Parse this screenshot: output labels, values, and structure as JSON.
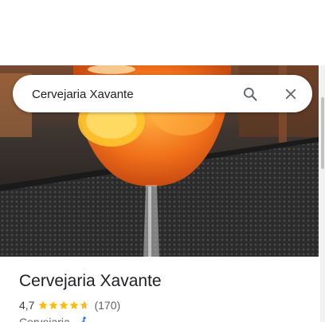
{
  "search": {
    "value": "Cervejaria Xavante",
    "search_icon": "search-icon",
    "close_icon": "close-icon"
  },
  "hero_photo": {
    "description_icon": "photo"
  },
  "place": {
    "name": "Cervejaria Xavante",
    "rating": "4,7",
    "stars": 4.7,
    "reviews": "(170)",
    "category": "Cervejaria",
    "separator": "·",
    "accessibility_icon": "wheelchair-icon"
  },
  "colors": {
    "star": "#fbbc04",
    "text_primary": "#202124",
    "text_secondary": "#5f6368",
    "accessibility": "#1a73e8"
  }
}
